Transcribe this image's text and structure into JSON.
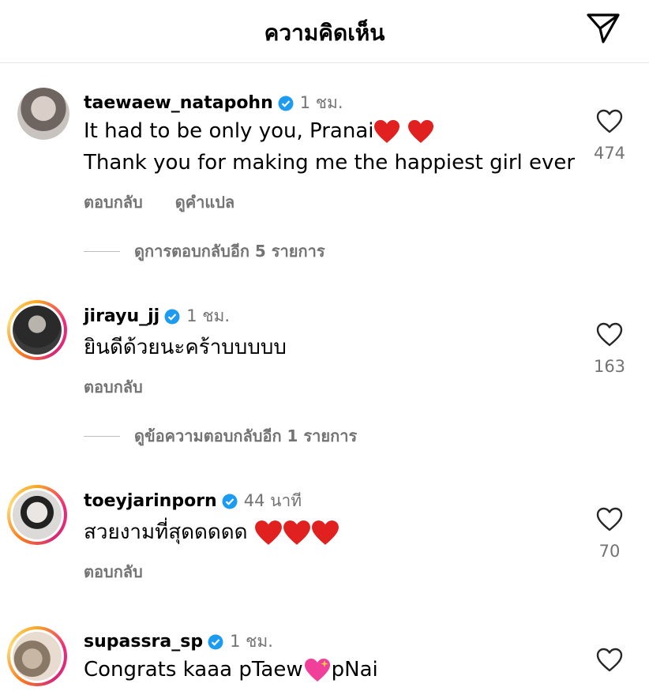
{
  "header": {
    "title": "ความคิดเห็น"
  },
  "comments": [
    {
      "username": "taewaew_natapohn",
      "time": "1 ชม.",
      "line1": "It had to be only you, Pranai",
      "line2": "Thank you for making me the happiest girl ever",
      "likes": "474",
      "reply_label": "ตอบกลับ",
      "translate_label": "ดูคำแปล",
      "more_replies": "ดูการตอบกลับอีก 5 รายการ"
    },
    {
      "username": "jirayu_jj",
      "time": "1 ชม.",
      "line1": "ยินดีด้วยนะคร้าบบบบบ",
      "likes": "163",
      "reply_label": "ตอบกลับ",
      "more_replies": "ดูข้อความตอบกลับอีก 1 รายการ"
    },
    {
      "username": "toeyjarinporn",
      "time": "44 นาที",
      "line1": "สวยงามที่สุดดดดด",
      "likes": "70",
      "reply_label": "ตอบกลับ"
    },
    {
      "username": "supassra_sp",
      "time": "1 ชม.",
      "line1a": "Congrats kaaa pTaew",
      "line1b": "pNai"
    }
  ],
  "icons": {
    "verified": "verified-badge-icon",
    "heart": "heart-outline-icon",
    "send": "send-icon"
  },
  "colors": {
    "verified": "#1d9bf0",
    "secondary_text": "#737373",
    "emoji_heart": "#e0211f"
  }
}
